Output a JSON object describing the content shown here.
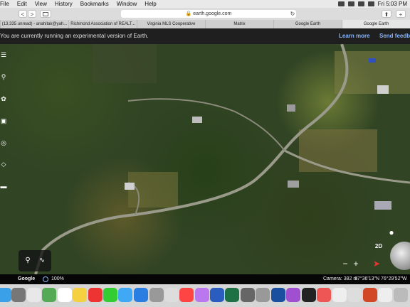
{
  "menubar": {
    "items": [
      "File",
      "Edit",
      "View",
      "History",
      "Bookmarks",
      "Window",
      "Help"
    ],
    "clock": "Fri 5:03 PM"
  },
  "toolbar": {
    "back": "<",
    "forward": ">",
    "address": "earth.google.com"
  },
  "tabs": [
    "(13,335 unread) - anahitak@yah...",
    "Richmond Association of REALT...",
    "Virginia MLS Cooperative",
    "Matrix",
    "Google Earth",
    "Google Earth"
  ],
  "banner": {
    "message": "You are currently running an experimental version of Earth.",
    "learn_more": "Learn more",
    "send_feedback": "Send feedback"
  },
  "map_controls": {
    "mode_2d": "2D",
    "zoom_out": "−",
    "zoom_in": "+"
  },
  "statusbar": {
    "logo": "Google",
    "zoom": "100%",
    "camera": "Camera: 382 m",
    "coordinates": "37°36'13\"N 76°29'52\"W"
  },
  "icons": [
    "menu-icon",
    "search-icon",
    "voyager-icon",
    "projects-icon",
    "measure-icon",
    "layers-icon",
    "map-style-icon",
    "pin-icon",
    "path-icon",
    "pegman-icon",
    "compass-icon",
    "globe-icon"
  ]
}
